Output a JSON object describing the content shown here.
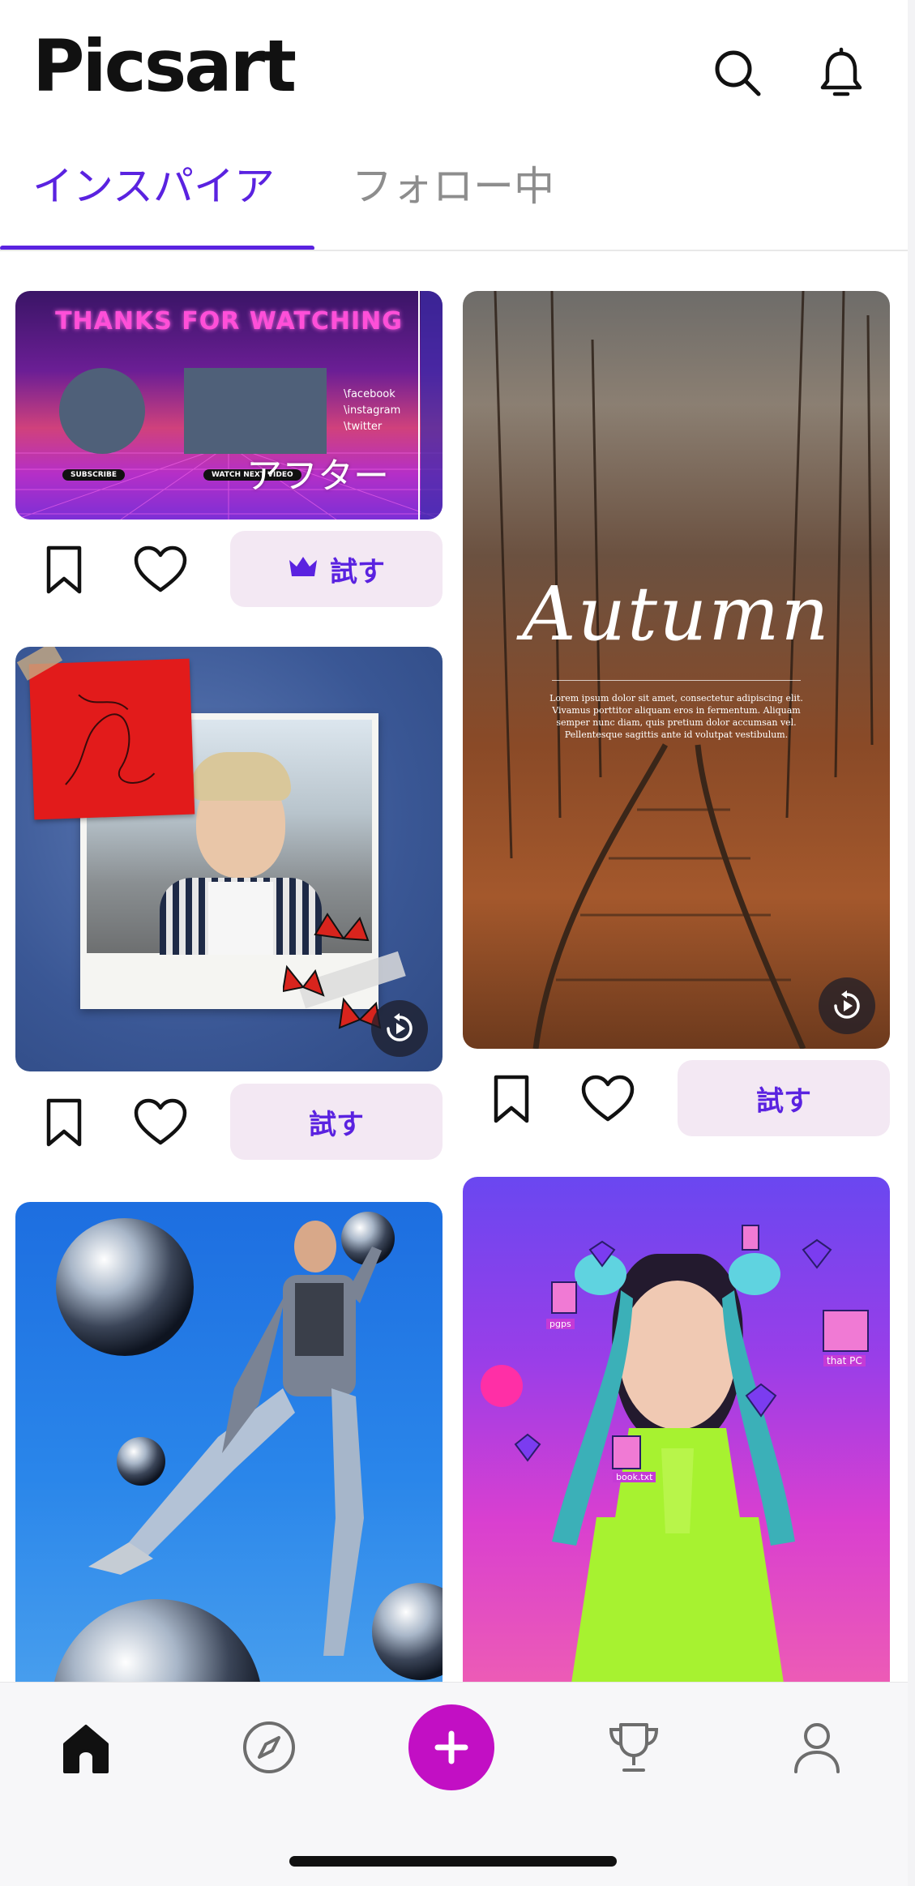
{
  "app": {
    "name": "Picsart"
  },
  "tabs": [
    {
      "label": "インスパイア",
      "active": true
    },
    {
      "label": "フォロー中",
      "active": false
    }
  ],
  "colors": {
    "accent": "#5a22e0",
    "create_button": "#c20fc4",
    "try_button_bg": "#f3e8f3"
  },
  "cards": {
    "thanks": {
      "title": "THANKS FOR WATCHING",
      "social": [
        "\\facebook",
        "\\instagram",
        "\\twitter"
      ],
      "subscribe": "SUBSCRIBE",
      "watch_next": "WATCH NEXT VIDEO",
      "after": "アフター",
      "try_label": "試す",
      "premium": true
    },
    "autumn": {
      "title": "Autumn",
      "body": "Lorem ipsum dolor sit amet, consectetur adipiscing elit. Vivamus porttitor aliquam eros in fermentum. Aliquam semper nunc diam, quis pretium dolor accumsan vel. Pellentesque sagittis ante id volutpat vestibulum.",
      "try_label": "試す"
    },
    "collage": {
      "try_label": "試す"
    },
    "chrome": {},
    "y2k": {
      "stickers": [
        "pgps",
        "that PC",
        "book.txt"
      ]
    }
  },
  "icons": {
    "search": "search-icon",
    "bell": "bell-icon",
    "bookmark": "bookmark-icon",
    "like": "heart-icon",
    "crown": "crown-icon",
    "replay": "replay-icon",
    "home": "home-icon",
    "discover": "compass-icon",
    "create": "plus-icon",
    "challenges": "trophy-icon",
    "profile": "profile-icon"
  }
}
